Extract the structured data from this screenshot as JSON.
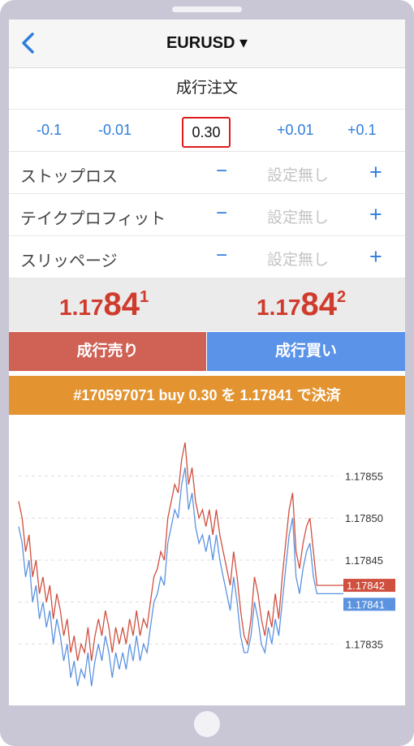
{
  "header": {
    "back_icon": "chevron-left-icon",
    "symbol": "EURUSD ▾"
  },
  "order": {
    "type": "成行注文",
    "lot": {
      "minus_big": "-0.1",
      "minus_small": "-0.01",
      "value": "0.30",
      "plus_small": "+0.01",
      "plus_big": "+0.1"
    },
    "params": [
      {
        "label": "ストップロス",
        "minus": "−",
        "value": "設定無し",
        "plus": "+"
      },
      {
        "label": "テイクプロフィット",
        "minus": "−",
        "value": "設定無し",
        "plus": "+"
      },
      {
        "label": "スリッページ",
        "minus": "−",
        "value": "設定無し",
        "plus": "+"
      }
    ]
  },
  "prices": {
    "sell": {
      "head": "1.17",
      "big": "84",
      "sup": "1"
    },
    "buy": {
      "head": "1.17",
      "big": "84",
      "sup": "2"
    }
  },
  "buttons": {
    "sell": "成行売り",
    "buy": "成行買い",
    "close": "#170597071 buy 0.30 を 1.17841 で決済"
  },
  "colors": {
    "accent": "#2f7ddc",
    "sell": "#cf6155",
    "buy": "#5a93e8",
    "close": "#e39431",
    "price": "#cf3b2c"
  },
  "chart_data": {
    "type": "line",
    "y_ticks": [
      "1.17855",
      "1.17850",
      "1.17845",
      "1.17840",
      "1.17835"
    ],
    "y_tick_values": [
      1.17855,
      1.1785,
      1.17845,
      1.1784,
      1.17835
    ],
    "ylim": [
      1.17828,
      1.17862
    ],
    "grid": true,
    "series": [
      {
        "role": "ask",
        "color": "#d0503f",
        "values": [
          1.17852,
          1.1785,
          1.17846,
          1.17848,
          1.17843,
          1.17845,
          1.17841,
          1.17843,
          1.1784,
          1.17842,
          1.17838,
          1.17841,
          1.17839,
          1.17836,
          1.17838,
          1.17834,
          1.17836,
          1.17833,
          1.17835,
          1.17834,
          1.17837,
          1.17833,
          1.17836,
          1.17838,
          1.17836,
          1.17839,
          1.17837,
          1.17834,
          1.17837,
          1.17835,
          1.17837,
          1.17835,
          1.17838,
          1.17836,
          1.17839,
          1.17836,
          1.17838,
          1.17837,
          1.1784,
          1.17843,
          1.17844,
          1.17846,
          1.17845,
          1.1785,
          1.17852,
          1.17854,
          1.17853,
          1.17857,
          1.17859,
          1.17854,
          1.17856,
          1.17852,
          1.1785,
          1.17851,
          1.17849,
          1.17851,
          1.17848,
          1.17851,
          1.17848,
          1.17846,
          1.17844,
          1.17842,
          1.17846,
          1.17843,
          1.17839,
          1.17836,
          1.17835,
          1.17838,
          1.17843,
          1.17841,
          1.17838,
          1.17836,
          1.17839,
          1.17837,
          1.17841,
          1.17838,
          1.17843,
          1.17847,
          1.17851,
          1.17853,
          1.17846,
          1.17844,
          1.17847,
          1.17849,
          1.1785,
          1.17846,
          1.17842,
          1.17842,
          1.17842,
          1.17842,
          1.17842,
          1.17842,
          1.17842
        ]
      },
      {
        "role": "bid",
        "color": "#5b93e0",
        "values": [
          1.17849,
          1.17847,
          1.17843,
          1.17845,
          1.1784,
          1.17842,
          1.17838,
          1.1784,
          1.17837,
          1.17839,
          1.17835,
          1.17838,
          1.17836,
          1.17833,
          1.17835,
          1.17831,
          1.17833,
          1.1783,
          1.17832,
          1.17831,
          1.17834,
          1.1783,
          1.17833,
          1.17835,
          1.17833,
          1.17836,
          1.17834,
          1.17831,
          1.17834,
          1.17832,
          1.17834,
          1.17832,
          1.17835,
          1.17833,
          1.17836,
          1.17833,
          1.17835,
          1.17834,
          1.17837,
          1.1784,
          1.17841,
          1.17843,
          1.17842,
          1.17847,
          1.17849,
          1.17851,
          1.1785,
          1.17854,
          1.17856,
          1.17851,
          1.17853,
          1.17849,
          1.17847,
          1.17848,
          1.17846,
          1.17848,
          1.17845,
          1.17848,
          1.17845,
          1.17843,
          1.17841,
          1.17839,
          1.17843,
          1.1784,
          1.17836,
          1.17834,
          1.17834,
          1.17836,
          1.1784,
          1.17838,
          1.17835,
          1.17834,
          1.17837,
          1.17835,
          1.17838,
          1.17836,
          1.1784,
          1.17844,
          1.17848,
          1.1785,
          1.17843,
          1.17841,
          1.17844,
          1.17846,
          1.17847,
          1.17843,
          1.17841,
          1.17841,
          1.17841,
          1.17841,
          1.17841,
          1.17841,
          1.17841
        ]
      }
    ],
    "current_labels": [
      {
        "text": "1.17842",
        "color": "#d0503f"
      },
      {
        "text": "1.17841",
        "color": "#5b93e0"
      }
    ]
  }
}
